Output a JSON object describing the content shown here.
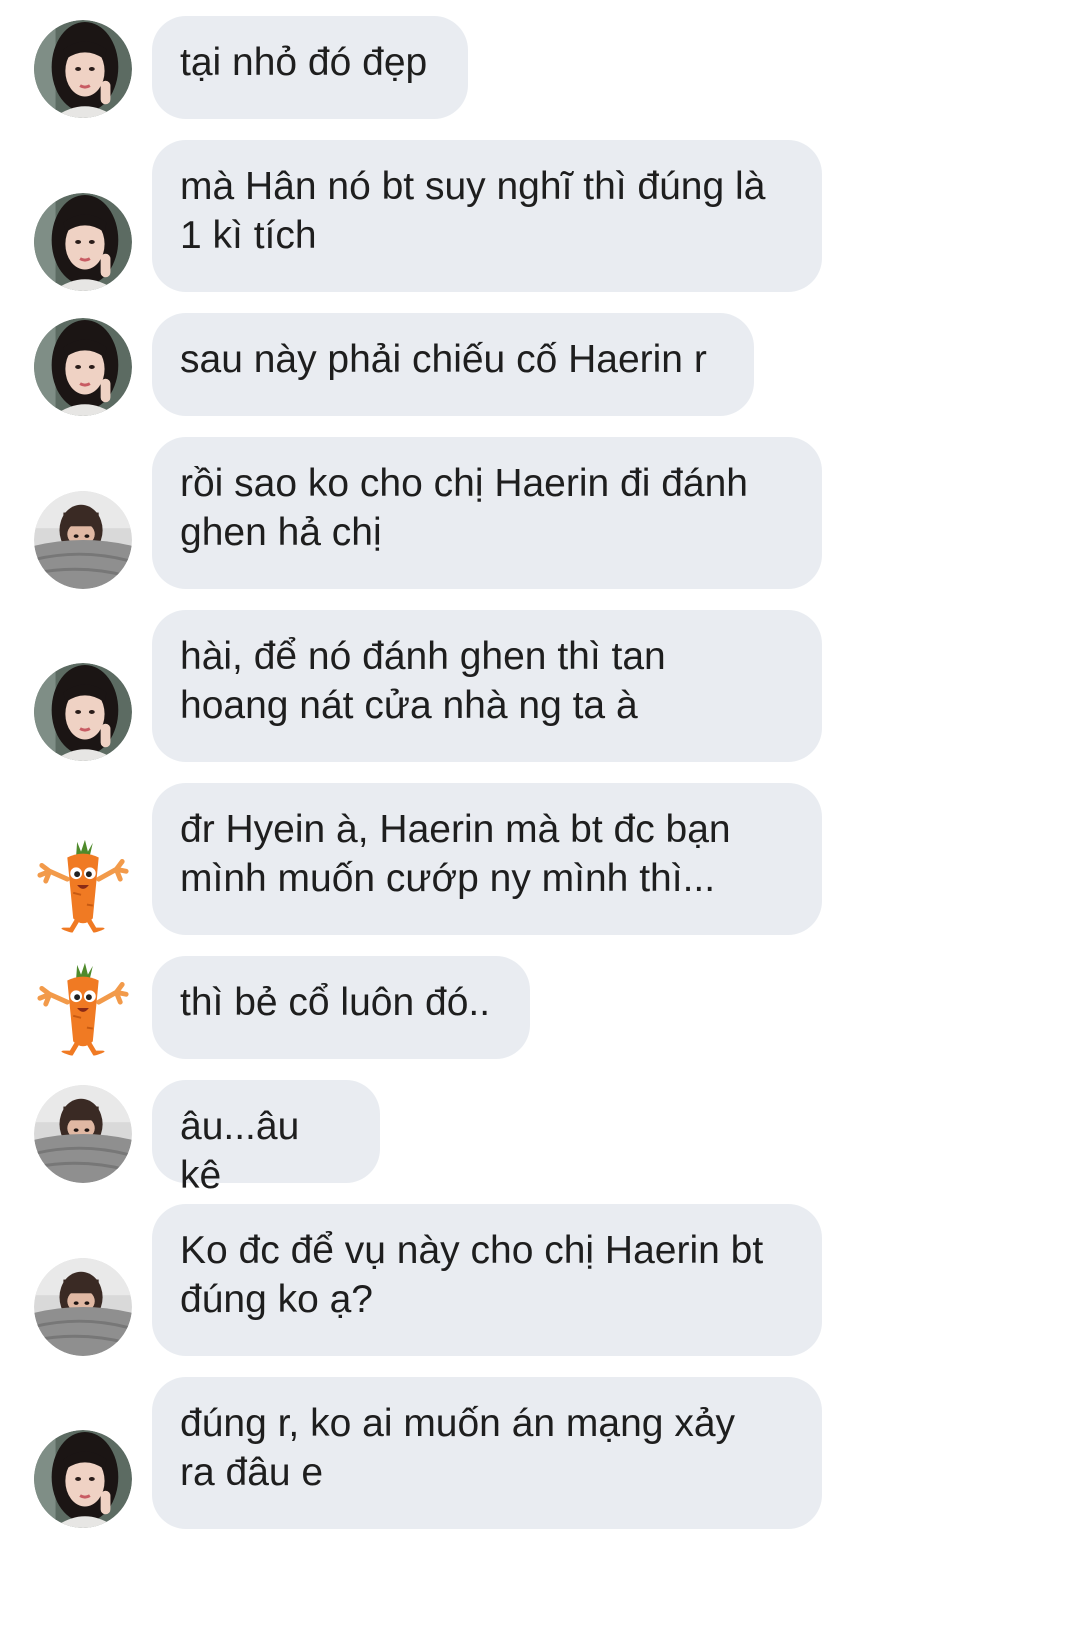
{
  "messages": [
    {
      "sender": "girl",
      "avatar_icon": "girl-avatar-icon",
      "text": "tại nhỏ đó đẹp"
    },
    {
      "sender": "girl",
      "avatar_icon": "girl-avatar-icon",
      "text": "mà Hân nó bt suy nghĩ thì đúng là\n1 kì tích"
    },
    {
      "sender": "girl",
      "avatar_icon": "girl-avatar-icon",
      "text": "sau này phải chiếu cố Haerin r"
    },
    {
      "sender": "blanket",
      "avatar_icon": "blanket-avatar-icon",
      "text": "rồi sao ko cho chị Haerin đi đánh\nghen hả chị"
    },
    {
      "sender": "girl",
      "avatar_icon": "girl-avatar-icon",
      "text": "hài, để nó đánh ghen thì tan\nhoang nát cửa nhà ng ta à"
    },
    {
      "sender": "carrot",
      "avatar_icon": "carrot-avatar-icon",
      "text": "đr Hyein à, Haerin mà bt đc bạn\nmình muốn cướp ny mình thì..."
    },
    {
      "sender": "carrot",
      "avatar_icon": "carrot-avatar-icon",
      "text": "thì bẻ cổ luôn đó.."
    },
    {
      "sender": "blanket",
      "avatar_icon": "blanket-avatar-icon",
      "text": "âu...âu kê"
    },
    {
      "sender": "blanket",
      "avatar_icon": "blanket-avatar-icon",
      "text": "Ko đc để vụ này cho chị Haerin bt\nđúng ko ạ?"
    },
    {
      "sender": "girl",
      "avatar_icon": "girl-avatar-icon",
      "text": "đúng r, ko ai muốn án mạng xảy\nra đâu e"
    }
  ],
  "colors": {
    "bubble_bg": "#e9ecf1",
    "text": "#1e1e1e",
    "background": "#ffffff"
  }
}
